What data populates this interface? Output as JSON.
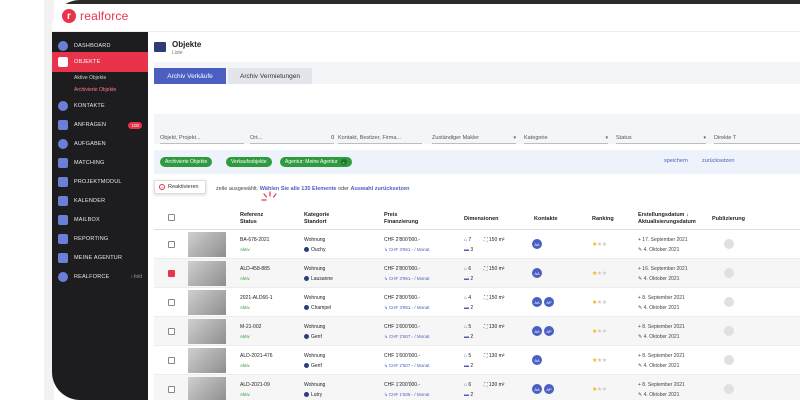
{
  "brand": {
    "name": "realforce",
    "accent": "#e8334a",
    "primary": "#4a5fc1"
  },
  "sidebar": {
    "items": [
      {
        "label": "DASHBOARD",
        "icon": "dashboard-icon"
      },
      {
        "label": "OBJEKTE",
        "icon": "building-icon",
        "active": true
      },
      {
        "label": "KONTAKTE",
        "icon": "contacts-icon"
      },
      {
        "label": "ANFRAGEN",
        "icon": "inquiry-icon",
        "badge": "100"
      },
      {
        "label": "AUFGABEN",
        "icon": "tasks-icon"
      },
      {
        "label": "MATCHING",
        "icon": "matching-icon"
      },
      {
        "label": "PROJEKTMODUL",
        "icon": "project-icon"
      },
      {
        "label": "KALENDER",
        "icon": "calendar-icon"
      },
      {
        "label": "MAILBOX",
        "icon": "mail-icon"
      },
      {
        "label": "REPORTING",
        "icon": "reporting-icon"
      },
      {
        "label": "MEINE AGENTUR",
        "icon": "agency-icon"
      },
      {
        "label": "REALFORCE",
        "icon": "realforce-icon"
      }
    ],
    "sub_items": [
      "Aktive Objekte",
      "Archivierte Objekte"
    ],
    "collapse_label": "‹ fold"
  },
  "page": {
    "title": "Objekte",
    "subtitle": "Liste"
  },
  "tabs": [
    "Archiv Verkäufe",
    "Archiv Vermietungen"
  ],
  "filters": {
    "objekt": "Objekt, Projekt...",
    "ort": "Ort...",
    "ort_suffix": "0",
    "kontakt": "Kontakt, Besitzer, Firma...",
    "makler": "Zuständiger Makler",
    "kategorie": "Kategorie",
    "status": "Status",
    "direkte": "Direkte T"
  },
  "chips": [
    "Archivierte Objekte",
    "Verkaufsobjekte",
    "Agentur: Meine Agentur"
  ],
  "actions": {
    "save": "speichern",
    "reset": "zurücksetzen"
  },
  "selection": {
    "menu_item": "Reaktivieren",
    "prefix": "zeile ausgewählt.",
    "select_all": "Wählen Sie alle 135 Elemente",
    "middle": "oder",
    "reset": "Auswahl zurücksetzen"
  },
  "table": {
    "headers": {
      "referenz": [
        "Referenz",
        "Status"
      ],
      "kategorie": [
        "Kategorie",
        "Standort"
      ],
      "preis": [
        "Preis",
        "Finanzierung"
      ],
      "dimensionen": "Dimensionen",
      "kontakte": "Kontakte",
      "ranking": "Ranking",
      "erstellung": [
        "Erstellungsdatum ↓",
        "Aktualisierungsdatum"
      ],
      "publizierung": "Publizierung"
    },
    "rows": [
      {
        "ref": "BA-678-2021",
        "status": "Aktiv",
        "kategorie": "Wohnung",
        "ort": "Ouchy",
        "preis": "CHF 2'800'000.-",
        "fin": "↳ CHF 3'961.- / Monat",
        "zimmer": "7",
        "flaeche": "150 m²",
        "bad": "3",
        "kontakte": [
          "AA"
        ],
        "stars": 1,
        "erstellt": "+ 17. September 2021",
        "aktualisiert": "✎ 4. Oktober 2021",
        "checked": false
      },
      {
        "ref": "ALD-458-885",
        "status": "Aktiv",
        "kategorie": "Wohnung",
        "ort": "Lausanne",
        "preis": "CHF 2'800'000.-",
        "fin": "↳ CHF 3'961.- / Monat",
        "zimmer": "6",
        "flaeche": "150 m²",
        "bad": "2",
        "kontakte": [
          "AA"
        ],
        "stars": 1,
        "erstellt": "+ 16. September 2021",
        "aktualisiert": "✎ 4. Oktober 2021",
        "checked": true
      },
      {
        "ref": "2021-ALD66-1",
        "status": "Aktiv",
        "kategorie": "Wohnung",
        "ort": "Champel",
        "preis": "CHF 2'800'000.-",
        "fin": "↳ CHF 3'961.- / Monat",
        "zimmer": "4",
        "flaeche": "150 m²",
        "bad": "2",
        "kontakte": [
          "AA",
          "AP"
        ],
        "stars": 1,
        "erstellt": "+ 8. September 2021",
        "aktualisiert": "✎ 4. Oktober 2021",
        "checked": false
      },
      {
        "ref": "M-21-002",
        "status": "Aktiv",
        "kategorie": "Wohnung",
        "ort": "Genf",
        "preis": "CHF 1'600'000.-",
        "fin": "↳ CHF 2'507.- / Monat",
        "zimmer": "5",
        "flaeche": "130 m²",
        "bad": "2",
        "kontakte": [
          "AA",
          "AP"
        ],
        "stars": 1,
        "erstellt": "+ 8. September 2021",
        "aktualisiert": "✎ 4. Oktober 2021",
        "checked": false
      },
      {
        "ref": "ALD-2021-476",
        "status": "Aktiv",
        "kategorie": "Wohnung",
        "ort": "Genf",
        "preis": "CHF 1'600'000.-",
        "fin": "↳ CHF 2'507.- / Monat",
        "zimmer": "5",
        "flaeche": "130 m²",
        "bad": "2",
        "kontakte": [
          "AA"
        ],
        "stars": 1,
        "erstellt": "+ 8. September 2021",
        "aktualisiert": "✎ 4. Oktober 2021",
        "checked": false
      },
      {
        "ref": "ALD-2021-09",
        "status": "Aktiv",
        "kategorie": "Wohnung",
        "ort": "Lutry",
        "preis": "CHF 1'200'000.-",
        "fin": "↳ CHF 1'505.- / Monat",
        "zimmer": "6",
        "flaeche": "130 m²",
        "bad": "2",
        "kontakte": [
          "AA",
          "AP"
        ],
        "stars": 1,
        "erstellt": "+ 8. September 2021",
        "aktualisiert": "✎ 4. Oktober 2021",
        "checked": false
      }
    ]
  }
}
